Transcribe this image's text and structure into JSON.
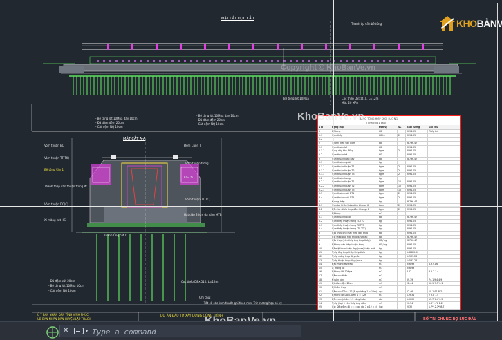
{
  "drawing": {
    "top_title": "MẶT CẮT DỌC CẦU",
    "section_title": "MẶT CẮT A-A",
    "top_labels": {
      "label_1": "Thanh ốp vần bê tông",
      "label_2": "Bê tông lót 10Mpa",
      "label_3": "Cọc thép D8×D10, L=12m",
      "label_4": "Mác 20 MPa",
      "note_a": "- Bê tông lót 10Mpa dày 10cm",
      "note_b": "- Đá dăm đệm 20cm",
      "note_c": "- Cát đệm NQ 10cm",
      "note_d": "- Bê tông lót 10Mpa dày 10cm",
      "note_e": "- Đá dăm đệm 20cm",
      "note_f": "- Cát đệm NQ 10cm"
    },
    "section_labels": {
      "l1": "Vòm thuận BC",
      "l2": "Vòm thuận TT(TK)",
      "l3": "Đệm Cuộn T",
      "l4": "Vòm thuận trong",
      "l5": "Bê tông Ván 1",
      "l6": "KG-Lãi",
      "l7": "Thanh thép ván thuận trong W",
      "l8": "Vòm thuận DC(C)",
      "l9": "Vòm thuận TT(TC)",
      "l10": "Hát đáp 20cm đá dăm MTB",
      "l11": "Xi măng cát HS",
      "l12": "Thanh Ống cốt D",
      "l13": "Cọc thép D8×D10, L=12m",
      "l14": "- Đá đệm cát 20cm",
      "l15": "- Bê tông lót 10Mpa 10cm",
      "l16": "- Cát đệm NQ 10cm",
      "note_title": "Ghi chú:",
      "note_text": "- Tất cả các kích thước ghi theo mm. Trừ trường hợp có ký."
    },
    "table": {
      "title": "BẢNG TỔNG HỢP KHỐI LƯỢNG",
      "unit": "(Tính cho 1 cầu)",
      "headers": [
        "STT",
        "Hạng mục",
        "Đơn vị",
        "SL",
        "Khối lượng",
        "Ghi chú"
      ],
      "rows": [
        [
          "1",
          "Bê tông",
          "kG",
          "",
          "3094.05",
          "Thép thô"
        ],
        [
          "1.1",
          "Vòm thép",
          "kG/m",
          "2",
          "3094.05",
          ""
        ],
        [
          "1.2",
          "",
          "",
          "",
          "",
          ""
        ],
        [
          "2",
          "Thanh thép vần giam",
          "kg",
          "",
          "38796.47",
          ""
        ],
        [
          "2.1",
          "Vòm thuận bé",
          "kG",
          "",
          "3094.05",
          ""
        ],
        [
          "2.1.1",
          "Vòng dây hàn đồng",
          "kg/m",
          "2",
          "3094.05",
          ""
        ],
        [
          "2.2",
          "Vòm thuận bé",
          "kG",
          "",
          "3094.05",
          ""
        ],
        [
          "3",
          "Vòm thuận thép dây",
          "kg",
          "",
          "38796.47",
          ""
        ],
        [
          "3.1",
          "Vòm thuận ngoài",
          "kg",
          "",
          "",
          ""
        ],
        [
          "3.1.1",
          "Vòm thuận thuận T1",
          "kg/m",
          "2",
          "3094.05",
          ""
        ],
        [
          "3.1.2",
          "Vòm thuận thuận T2",
          "kg/m",
          "2",
          "3094.05",
          ""
        ],
        [
          "3.1.3",
          "Vòm thuận thuận T3",
          "kg/m",
          "2",
          "3094.05",
          ""
        ],
        [
          "3.2",
          "Vòm thuận trong",
          "kg",
          "",
          "",
          ""
        ],
        [
          "3.2.1",
          "Vòm thuận thuận T1",
          "kg/m",
          "10",
          "3094.05",
          ""
        ],
        [
          "3.2.2",
          "Vòm thuận thuận T2",
          "kg/m",
          "10",
          "3094.05",
          ""
        ],
        [
          "3.2.3",
          "Vòm thuận thuận T3",
          "kg/m",
          "10",
          "3094.05",
          ""
        ],
        [
          "3.3",
          "Vòm thuận cuối DT1",
          "kg/m",
          "2",
          "3094.05",
          ""
        ],
        [
          "3.4",
          "Vòm thuận cuối DT2",
          "kg/m",
          "2",
          "3094.05",
          ""
        ],
        [
          "4",
          "Khung thép",
          "kg",
          "",
          "38796.47",
          ""
        ],
        [
          "4.1",
          "Vòm bé (thép thép dầm khung) 6",
          "kg/m",
          "2",
          "3094.05",
          ""
        ],
        [
          "4.2",
          "Dầm bé (thép thép dầm khung) 6",
          "kg/m",
          "2",
          "3094.05",
          ""
        ],
        [
          "5",
          "Bê tông",
          "m3",
          "",
          "",
          ""
        ],
        [
          "5.1",
          "Vòm thuận trong",
          "kg",
          "",
          "38796.47",
          ""
        ],
        [
          "5.2",
          "Vòm thép thuận trong TC-TTC",
          "kg",
          "",
          "3094.05",
          ""
        ],
        [
          "5.3",
          "Vòm thép thuận trong TC-TTC",
          "kg",
          "",
          "3094.05",
          ""
        ],
        [
          "5.4",
          "Vòm thép thuận trong (TC-TTC)",
          "kg",
          "",
          "3094.05",
          ""
        ],
        [
          "6",
          "Cốp thép ống mặt thép đáy thép",
          "kg",
          "",
          "3094.05",
          ""
        ],
        [
          "7",
          "Cốt thép ống mặt thép đáy thép",
          "kg",
          "",
          "38796.47",
          ""
        ],
        [
          "8",
          "Cốp thép (ván thép ống thép thép)",
          "kG / kg",
          "",
          "38796.47",
          ""
        ],
        [
          "9",
          "Bê tông ván thép thuận trong",
          "kG / kg",
          "",
          "3094.05",
          ""
        ],
        [
          "10",
          "Bề mặt hoàn thép ống (vnsz) thép mặt",
          "kg",
          "",
          "3094.05",
          ""
        ],
        [
          "11",
          "Thép ống thép thép thép thép",
          "kg",
          "",
          "148880.00",
          ""
        ],
        [
          "12",
          "Thép móng thép đáy cốc",
          "kg",
          "",
          "14533.28",
          ""
        ],
        [
          "13",
          "Thép thuận thép đáy (vnsz)",
          "kg",
          "",
          "14533.28",
          ""
        ],
        [
          "14",
          "Đắp móng M20Mpa",
          "m3",
          "",
          "346.99",
          "6.97 1.6"
        ],
        [
          "15",
          "Xi măng lót",
          "m3",
          "",
          "346.99",
          ""
        ],
        [
          "16",
          "Bê tông lót 10Mpa",
          "m3",
          "",
          "8.62",
          "3.6.2 1.4"
        ],
        [
          "17",
          "Dầm cọc thép",
          "m3",
          "",
          "",
          ""
        ],
        [
          "18",
          "Khuôn ván",
          "m3",
          "",
          "59.39",
          "74.1 9.4 4.9"
        ],
        [
          "19",
          "Đá dăm đệm 20cm",
          "m3",
          "",
          "22.44",
          "10.9*7.3*0.1"
        ],
        [
          "20",
          "Bể hầm thép",
          "m3",
          "",
          "",
          ""
        ],
        [
          "21",
          "Dầm cọc D10 x 12 (8 cọc bằng 1 = 12m)",
          "cọc",
          "",
          "22.46",
          "10.1*11.8*2"
        ],
        [
          "22",
          "Bê tông lót D8 (L6cm) 1 = 12m",
          "m3",
          "",
          "179.34",
          "2 3.8 7.4"
        ],
        [
          "23",
          "Dầm cọc (nhóm 1.5 vòng thép)",
          "cây",
          "",
          "140.00",
          "13.7*6.4*0.5"
        ],
        [
          "24",
          "Thép (loại 1 cần thép ống dầm)",
          "m3",
          "",
          "20.54",
          "1.8*1.76 1.2"
        ],
        [
          "25",
          "Cọc D8 x 6 m (8 x x x cọc dài 7 x 12 x x)",
          "Cọc",
          "",
          "2032",
          "1.7*12.7*98.7"
        ]
      ]
    },
    "titleblock": {
      "org_1": "Ủ Y BAN NHÂN DÂN TỈNH VĨNH PHÚC",
      "org_2": "UB BAN NHÂN DÂN HUYỆN LẬP THẠCH",
      "project": "DỰ ÁN ĐẦU TƯ XÂY DỰNG CÔNG TRÌNH",
      "sheet_title": "BỐ TRÍ CHUNG BỘ LỤC ĐẦU"
    }
  },
  "logo": {
    "brand_primary": "KHO",
    "brand_secondary": "BẢNVẼ",
    "brand_color": "#e0a020"
  },
  "watermark": {
    "text": "KhoBanVe.vn",
    "copyright": "Copyright © KhoBanVe.vn"
  },
  "command_line": {
    "placeholder": "Type a command",
    "close_glyph": "✕",
    "caret_glyph": "▾"
  }
}
